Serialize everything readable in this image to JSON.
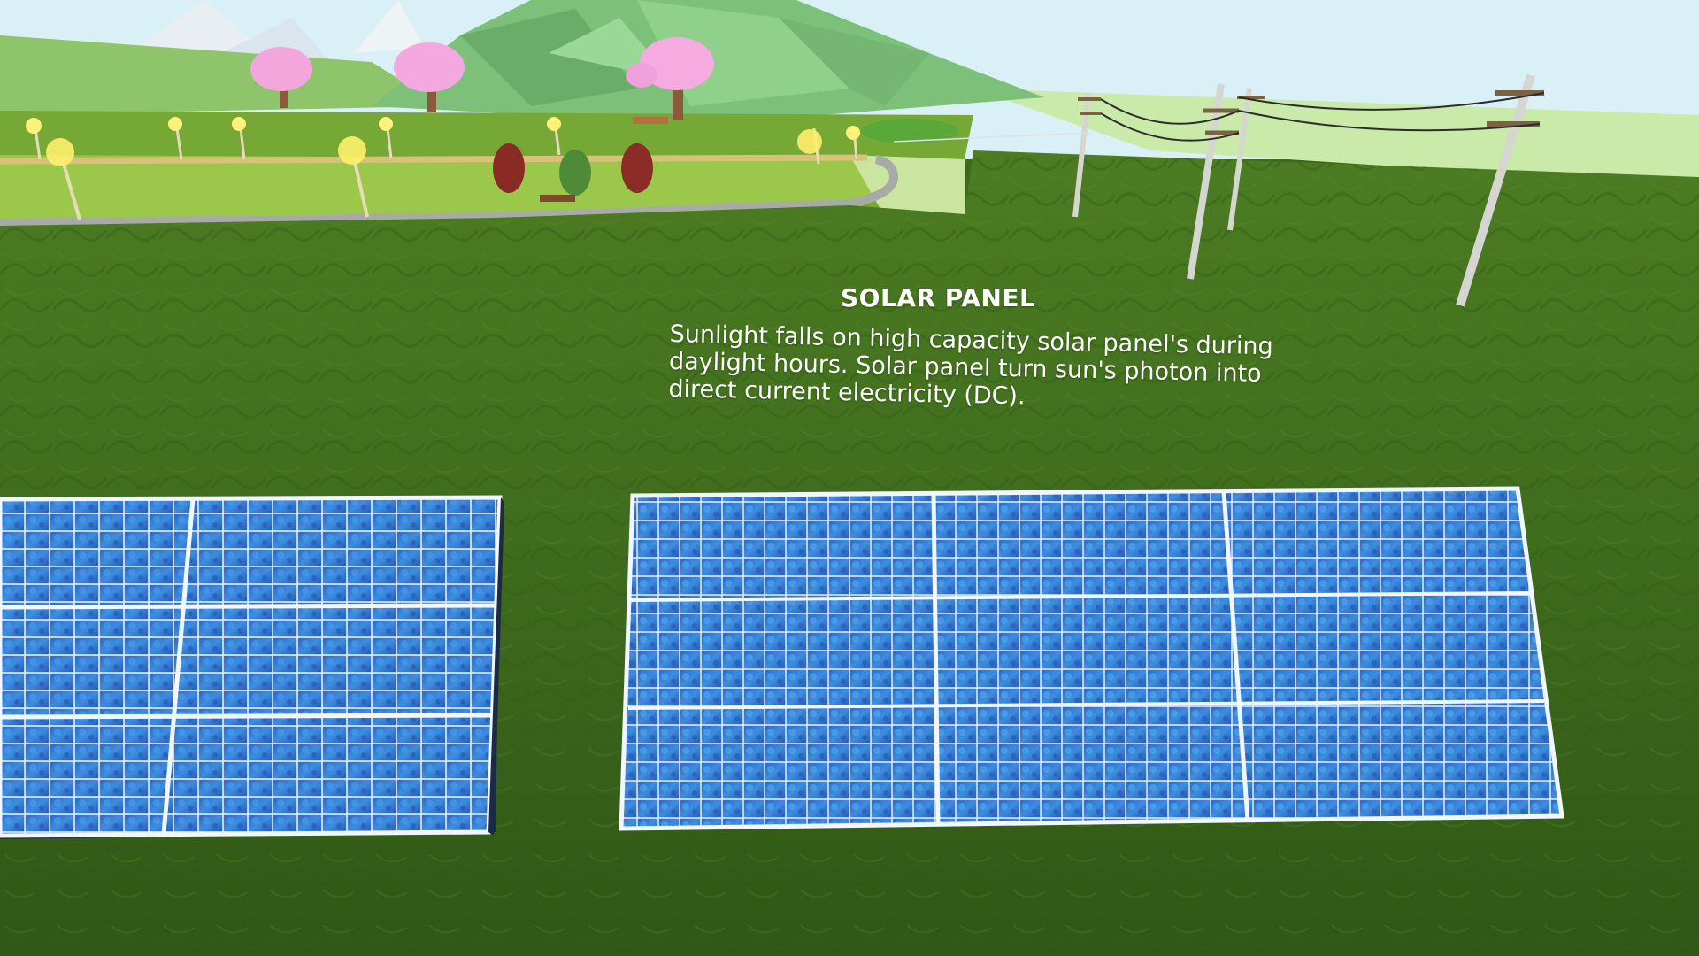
{
  "info_panel": {
    "title": "SOLAR PANEL",
    "description": "Sunlight falls on high capacity solar panel's during daylight hours. Solar panel turn sun's photon into direct current electricity (DC)."
  },
  "scene": {
    "objects": [
      "mountain",
      "pink-trees",
      "street-lamps",
      "park-path",
      "bench",
      "power-poles",
      "solar-panel-left",
      "solar-panel-right"
    ]
  },
  "colors": {
    "grass": "#3f6a1c",
    "panel_cell": "#2f6fd0",
    "panel_frame": "#f2f6ff",
    "mountain": "#7cc07a",
    "sky": "#d9f0f7"
  }
}
